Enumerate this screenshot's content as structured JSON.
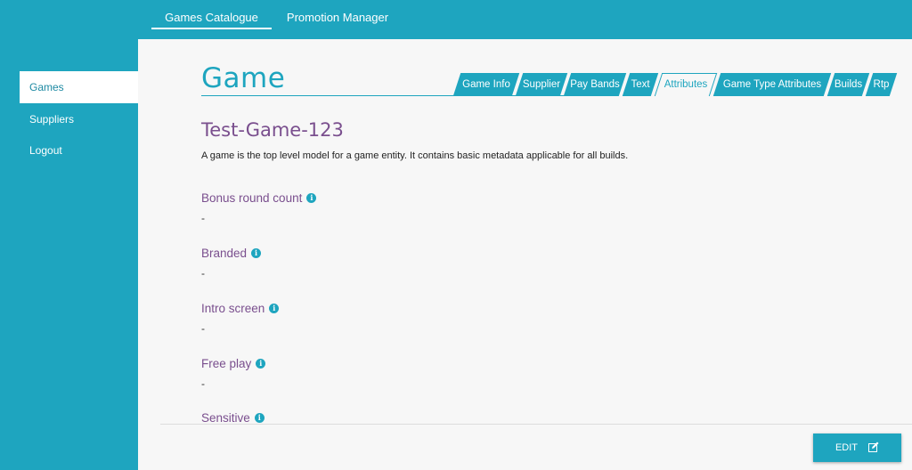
{
  "topnav": {
    "tabs": [
      {
        "label": "Games Catalogue",
        "active": true
      },
      {
        "label": "Promotion Manager",
        "active": false
      }
    ]
  },
  "sidebar": {
    "items": [
      {
        "label": "Games",
        "active": true
      },
      {
        "label": "Suppliers",
        "active": false
      },
      {
        "label": "Logout",
        "active": false
      }
    ]
  },
  "page": {
    "title": "Game",
    "game_name": "Test-Game-123",
    "description": "A game is the top level model for a game entity. It contains basic metadata applicable for all builds."
  },
  "tabs": [
    {
      "label": "Game Info",
      "active": false
    },
    {
      "label": "Supplier",
      "active": false
    },
    {
      "label": "Pay Bands",
      "active": false
    },
    {
      "label": "Text",
      "active": false
    },
    {
      "label": "Attributes",
      "active": true
    },
    {
      "label": "Game Type Attributes",
      "active": false
    },
    {
      "label": "Builds",
      "active": false
    },
    {
      "label": "Rtp",
      "active": false
    }
  ],
  "fields": [
    {
      "label": "Bonus round count",
      "value": "-"
    },
    {
      "label": "Branded",
      "value": "-"
    },
    {
      "label": "Intro screen",
      "value": "-"
    },
    {
      "label": "Free play",
      "value": "-"
    },
    {
      "label": "Sensitive",
      "value": ""
    }
  ],
  "actions": {
    "edit_label": "EDIT",
    "edit_icon": "pencil-square-icon"
  },
  "colors": {
    "brand": "#1ea5bf",
    "accent_purple": "#7a4f8e",
    "panel": "#f7f7f7"
  }
}
